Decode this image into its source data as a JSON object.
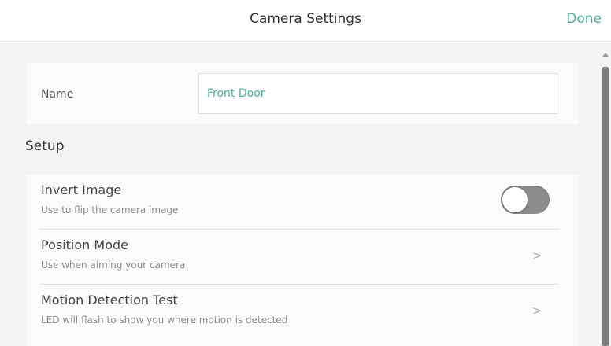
{
  "header": {
    "title": "Camera Settings",
    "done_label": "Done"
  },
  "name_card": {
    "label": "Name",
    "value": "Front Door"
  },
  "setup": {
    "heading": "Setup",
    "rows": [
      {
        "title": "Invert Image",
        "subtitle": "Use to flip the camera image",
        "control": "toggle",
        "toggle_on": false
      },
      {
        "title": "Position Mode",
        "subtitle": "Use when aiming your camera",
        "control": "chevron",
        "chevron": ">"
      },
      {
        "title": "Motion Detection Test",
        "subtitle": "LED will flash to show you where motion is detected",
        "control": "chevron",
        "chevron": ">"
      }
    ]
  },
  "colors": {
    "accent": "#4cb38a",
    "toggle_off": "#8c8c8c",
    "background": "#f4f4f4",
    "card": "#fbfbfb"
  },
  "icons": {
    "chevron": "chevron-right-icon",
    "scroll_up": "scroll-up-arrow-icon"
  }
}
